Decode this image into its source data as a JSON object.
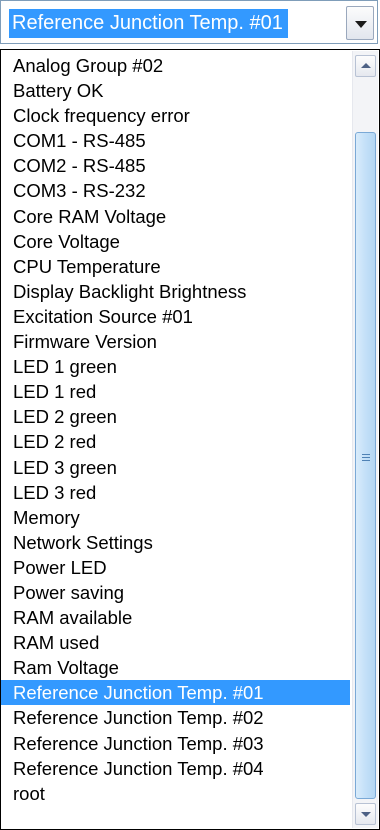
{
  "combo": {
    "selected_value": "Reference Junction Temp. #01"
  },
  "dropdown": {
    "items": [
      "Analog Group #02",
      "Battery OK",
      "Clock frequency error",
      "COM1 - RS-485",
      "COM2 - RS-485",
      "COM3 - RS-232",
      "Core RAM Voltage",
      "Core Voltage",
      "CPU Temperature",
      "Display Backlight Brightness",
      "Excitation Source #01",
      "Firmware Version",
      "LED 1 green",
      "LED 1 red",
      "LED 2 green",
      "LED 2 red",
      "LED 3 green",
      "LED 3 red",
      "Memory",
      "Network Settings",
      "Power LED",
      "Power saving",
      "RAM available",
      "RAM used",
      "Ram Voltage",
      "Reference Junction Temp. #01",
      "Reference Junction Temp. #02",
      "Reference Junction Temp. #03",
      "Reference Junction Temp. #04",
      "root"
    ],
    "selected_index": 25
  },
  "icons": {
    "combo_button": "chevron-down-icon",
    "scroll_up": "scroll-up-arrow-icon",
    "scroll_down": "scroll-down-arrow-icon",
    "scroll_grip": "grip-lines-icon"
  },
  "colors": {
    "selection": "#3399ff",
    "selection_text": "#ffffff",
    "scroll_thumb": "#c4e0f8"
  }
}
